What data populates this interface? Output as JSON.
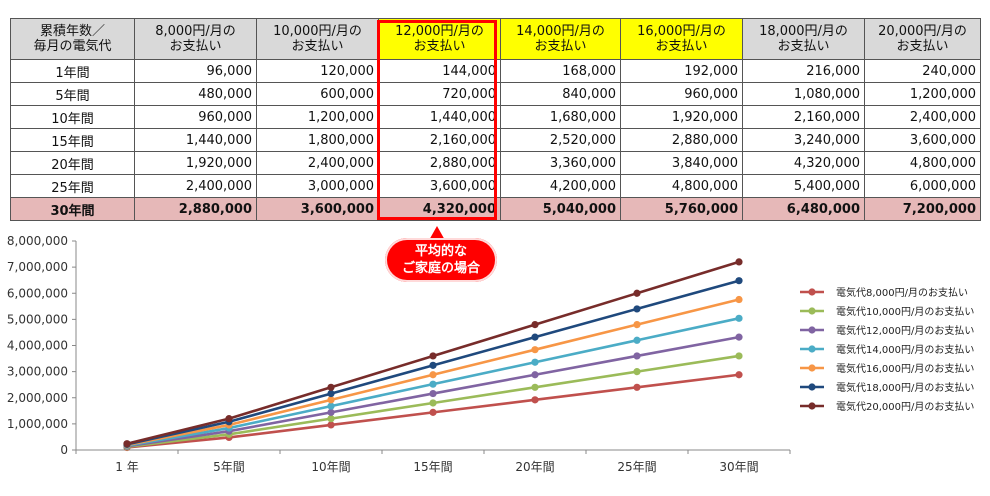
{
  "table": {
    "corner_header_line1": "累積年数／",
    "corner_header_line2": "毎月の電気代",
    "columns": [
      {
        "line1": "8,000円/月の",
        "line2": "お支払い"
      },
      {
        "line1": "10,000円/月の",
        "line2": "お支払い"
      },
      {
        "line1": "12,000円/月の",
        "line2": "お支払い"
      },
      {
        "line1": "14,000円/月の",
        "line2": "お支払い"
      },
      {
        "line1": "16,000円/月の",
        "line2": "お支払い"
      },
      {
        "line1": "18,000円/月の",
        "line2": "お支払い"
      },
      {
        "line1": "20,000円/月の",
        "line2": "お支払い"
      }
    ],
    "rows": [
      {
        "label": "1年間",
        "cells": [
          "96,000",
          "120,000",
          "144,000",
          "168,000",
          "192,000",
          "216,000",
          "240,000"
        ]
      },
      {
        "label": "5年間",
        "cells": [
          "480,000",
          "600,000",
          "720,000",
          "840,000",
          "960,000",
          "1,080,000",
          "1,200,000"
        ]
      },
      {
        "label": "10年間",
        "cells": [
          "960,000",
          "1,200,000",
          "1,440,000",
          "1,680,000",
          "1,920,000",
          "2,160,000",
          "2,400,000"
        ]
      },
      {
        "label": "15年間",
        "cells": [
          "1,440,000",
          "1,800,000",
          "2,160,000",
          "2,520,000",
          "2,880,000",
          "3,240,000",
          "3,600,000"
        ]
      },
      {
        "label": "20年間",
        "cells": [
          "1,920,000",
          "2,400,000",
          "2,880,000",
          "3,360,000",
          "3,840,000",
          "4,320,000",
          "4,800,000"
        ]
      },
      {
        "label": "25年間",
        "cells": [
          "2,400,000",
          "3,000,000",
          "3,600,000",
          "4,200,000",
          "4,800,000",
          "5,400,000",
          "6,000,000"
        ]
      },
      {
        "label": "30年間",
        "cells": [
          "2,880,000",
          "3,600,000",
          "4,320,000",
          "5,040,000",
          "5,760,000",
          "6,480,000",
          "7,200,000"
        ]
      }
    ],
    "header_colors": {
      "default": "#d9d9d9",
      "highlight": "#ffff00",
      "total_row": "#e6b8b8"
    }
  },
  "callout": {
    "line1": "平均的な",
    "line2": "ご家庭の場合",
    "color": "#ff0000"
  },
  "chart_data": {
    "type": "line",
    "categories": [
      "1 年",
      "5年間",
      "10年間",
      "15年間",
      "20年間",
      "25年間",
      "30年間"
    ],
    "ylim": [
      0,
      8000000
    ],
    "yticks": [
      0,
      1000000,
      2000000,
      3000000,
      4000000,
      5000000,
      6000000,
      7000000,
      8000000
    ],
    "ytick_labels": [
      "0",
      "1,000,000",
      "2,000,000",
      "3,000,000",
      "4,000,000",
      "5,000,000",
      "6,000,000",
      "7,000,000",
      "8,000,000"
    ],
    "grid": false,
    "legend_position": "right",
    "series": [
      {
        "name": "電気代8,000円/月のお支払い",
        "color": "#c0504d",
        "values": [
          96000,
          480000,
          960000,
          1440000,
          1920000,
          2400000,
          2880000
        ]
      },
      {
        "name": "電気代10,000円/月のお支払い",
        "color": "#9bbb59",
        "values": [
          120000,
          600000,
          1200000,
          1800000,
          2400000,
          3000000,
          3600000
        ]
      },
      {
        "name": "電気代12,000円/月のお支払い",
        "color": "#8064a2",
        "values": [
          144000,
          720000,
          1440000,
          2160000,
          2880000,
          3600000,
          4320000
        ]
      },
      {
        "name": "電気代14,000円/月のお支払い",
        "color": "#4bacc6",
        "values": [
          168000,
          840000,
          1680000,
          2520000,
          3360000,
          4200000,
          5040000
        ]
      },
      {
        "name": "電気代16,000円/月のお支払い",
        "color": "#f79646",
        "values": [
          192000,
          960000,
          1920000,
          2880000,
          3840000,
          4800000,
          5760000
        ]
      },
      {
        "name": "電気代18,000円/月のお支払い",
        "color": "#1f497d",
        "values": [
          216000,
          1080000,
          2160000,
          3240000,
          4320000,
          5400000,
          6480000
        ]
      },
      {
        "name": "電気代20,000円/月のお支払い",
        "color": "#772c2a",
        "values": [
          240000,
          1200000,
          2400000,
          3600000,
          4800000,
          6000000,
          7200000
        ]
      }
    ]
  }
}
